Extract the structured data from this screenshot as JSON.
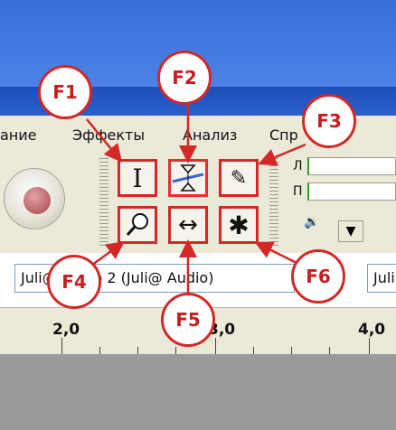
{
  "menu": {
    "items": [
      "ание",
      "Эффекты",
      "Анализ",
      "Спр"
    ]
  },
  "tools": {
    "selection_symbol": "I",
    "draw_symbol": "✎",
    "zoom_symbol": "⌕",
    "timeshift_symbol": "↔",
    "multi_symbol": "✱"
  },
  "meters": {
    "left_label": "Л",
    "right_label": "П",
    "volume_icon": "🔉",
    "dropdown_icon": "▼"
  },
  "device_select": {
    "value": "Juli@ Audio 2 (Juli@ Audio)",
    "right_value": "Juli"
  },
  "ruler": {
    "labels": [
      "2,0",
      "3,0",
      "4,0"
    ]
  },
  "callouts": {
    "f1": "F1",
    "f2": "F2",
    "f3": "F3",
    "f4": "F4",
    "f5": "F5",
    "f6": "F6"
  },
  "colors": {
    "callout_red": "#d42828",
    "toolbar_bg": "#ece9d8",
    "title_blue": "#1e4fb8"
  }
}
